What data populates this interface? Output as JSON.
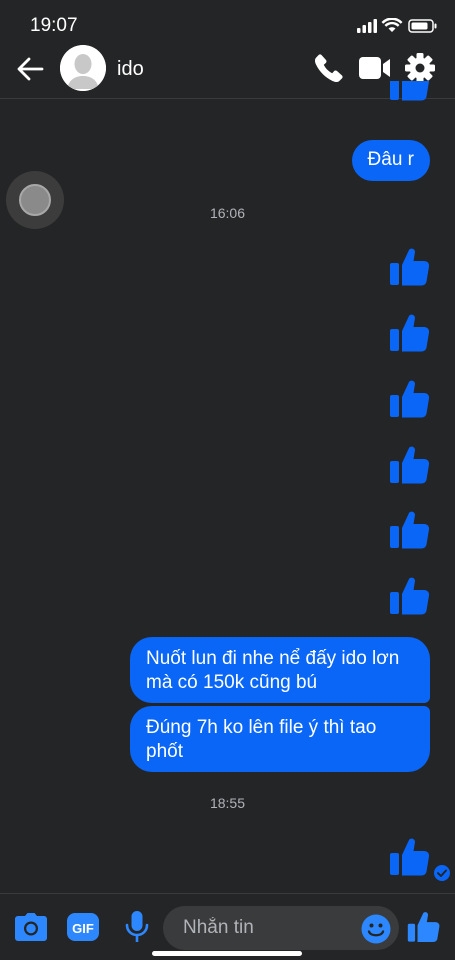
{
  "status_bar": {
    "time": "19:07"
  },
  "header": {
    "contact_name": "ido",
    "icons": [
      "back-arrow-icon",
      "phone-icon",
      "video-camera-icon",
      "gear-icon"
    ]
  },
  "thread": {
    "messages": [
      {
        "type": "sent_text",
        "text": "Đâu r"
      },
      {
        "type": "timestamp",
        "text": "16:06"
      },
      {
        "type": "sent_like"
      },
      {
        "type": "sent_like"
      },
      {
        "type": "sent_like"
      },
      {
        "type": "sent_like"
      },
      {
        "type": "sent_like"
      },
      {
        "type": "sent_like"
      },
      {
        "type": "sent_text",
        "text": "Nuốt lun đi nhe nể đấy ido lơn mà có 150k cũng bú"
      },
      {
        "type": "sent_text",
        "text": "Đúng 7h ko lên file ý thì tao phốt"
      },
      {
        "type": "timestamp",
        "text": "18:55"
      },
      {
        "type": "sent_like",
        "status": "seen"
      }
    ]
  },
  "composer": {
    "placeholder": "Nhắn tin",
    "gif_label": "GIF",
    "icons": [
      "camera-icon",
      "gif-icon",
      "microphone-icon",
      "emoji-icon",
      "thumbs-up-icon"
    ]
  },
  "colors": {
    "background": "#242526",
    "accent": "#0a66f7",
    "timestamp": "#b0b3b8"
  }
}
